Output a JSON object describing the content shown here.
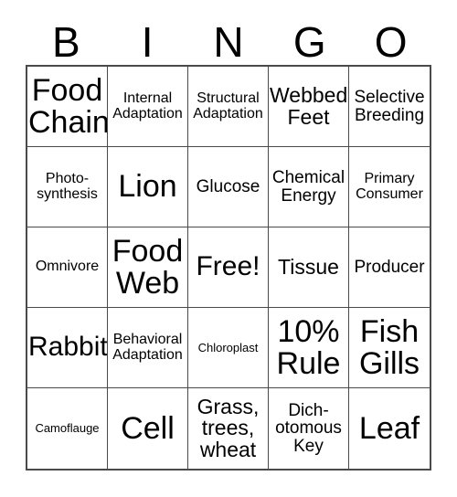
{
  "header": {
    "letters": [
      "B",
      "I",
      "N",
      "G",
      "O"
    ]
  },
  "grid": {
    "rows": 5,
    "columns": 5,
    "cells": [
      {
        "text": "Food\nChain",
        "size": "fs-xl"
      },
      {
        "text": "Internal\nAdaptation",
        "size": "fs-xs"
      },
      {
        "text": "Structural\nAdaptation",
        "size": "fs-xs"
      },
      {
        "text": "Webbed\nFeet",
        "size": "fs-md"
      },
      {
        "text": "Selective\nBreeding",
        "size": "fs-sm"
      },
      {
        "text": "Photo-\nsynthesis",
        "size": "fs-xs"
      },
      {
        "text": "Lion",
        "size": "fs-xl"
      },
      {
        "text": "Glucose",
        "size": "fs-sm"
      },
      {
        "text": "Chemical\nEnergy",
        "size": "fs-sm"
      },
      {
        "text": "Primary\nConsumer",
        "size": "fs-xs"
      },
      {
        "text": "Omnivore",
        "size": "fs-xs"
      },
      {
        "text": "Food\nWeb",
        "size": "fs-xl"
      },
      {
        "text": "Free!",
        "size": "fs-lg"
      },
      {
        "text": "Tissue",
        "size": "fs-md"
      },
      {
        "text": "Producer",
        "size": "fs-sm"
      },
      {
        "text": "Rabbit",
        "size": "fs-lg"
      },
      {
        "text": "Behavioral\nAdaptation",
        "size": "fs-xs"
      },
      {
        "text": "Chloroplast",
        "size": "fs-xxs"
      },
      {
        "text": "10%\nRule",
        "size": "fs-xl"
      },
      {
        "text": "Fish\nGills",
        "size": "fs-xl"
      },
      {
        "text": "Camoflauge",
        "size": "fs-xxs"
      },
      {
        "text": "Cell",
        "size": "fs-xl"
      },
      {
        "text": "Grass,\ntrees,\nwheat",
        "size": "fs-md"
      },
      {
        "text": "Dich-\notomous\nKey",
        "size": "fs-sm"
      },
      {
        "text": "Leaf",
        "size": "fs-xl"
      }
    ]
  }
}
